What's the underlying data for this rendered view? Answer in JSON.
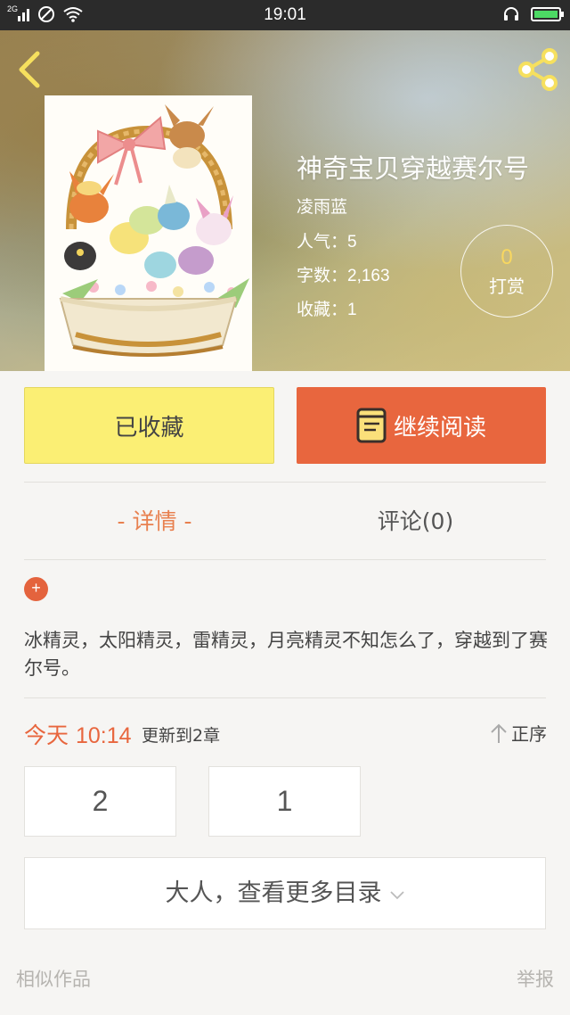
{
  "status_bar": {
    "network": "2G",
    "time": "19:01"
  },
  "header": {
    "back_icon": "chevron-left-icon",
    "share_icon": "share-icon"
  },
  "book": {
    "title": "神奇宝贝穿越赛尔号",
    "author": "凌雨蓝",
    "popularity_label": "人气：",
    "popularity": "5",
    "word_count_label": "字数：",
    "word_count": "2,163",
    "favorites_label": "收藏：",
    "favorites": "1",
    "cover_image": "eevee-basket-illustration"
  },
  "tip": {
    "count": "0",
    "label": "打赏"
  },
  "actions": {
    "favorited_label": "已收藏",
    "continue_label": "继续阅读",
    "continue_icon": "book-icon"
  },
  "tabs": {
    "detail": "- 详情 -",
    "comments": "评论(0)"
  },
  "description": {
    "expand_icon": "plus-icon",
    "text": "冰精灵，太阳精灵，雷精灵，月亮精灵不知怎么了，穿越到了赛尔号。"
  },
  "update": {
    "day": "今天",
    "time": "10:14",
    "text": "更新到2章",
    "order_label": "正序",
    "order_icon": "arrow-up-icon"
  },
  "chapters": [
    "2",
    "1"
  ],
  "more_catalog": "大人，查看更多目录",
  "footer": {
    "similar": "相似作品",
    "report": "举报"
  },
  "colors": {
    "accent_orange": "#e8663e",
    "favorite_yellow": "#fbef74",
    "tab_active": "#e8804f",
    "tip_count": "#f8d760"
  }
}
